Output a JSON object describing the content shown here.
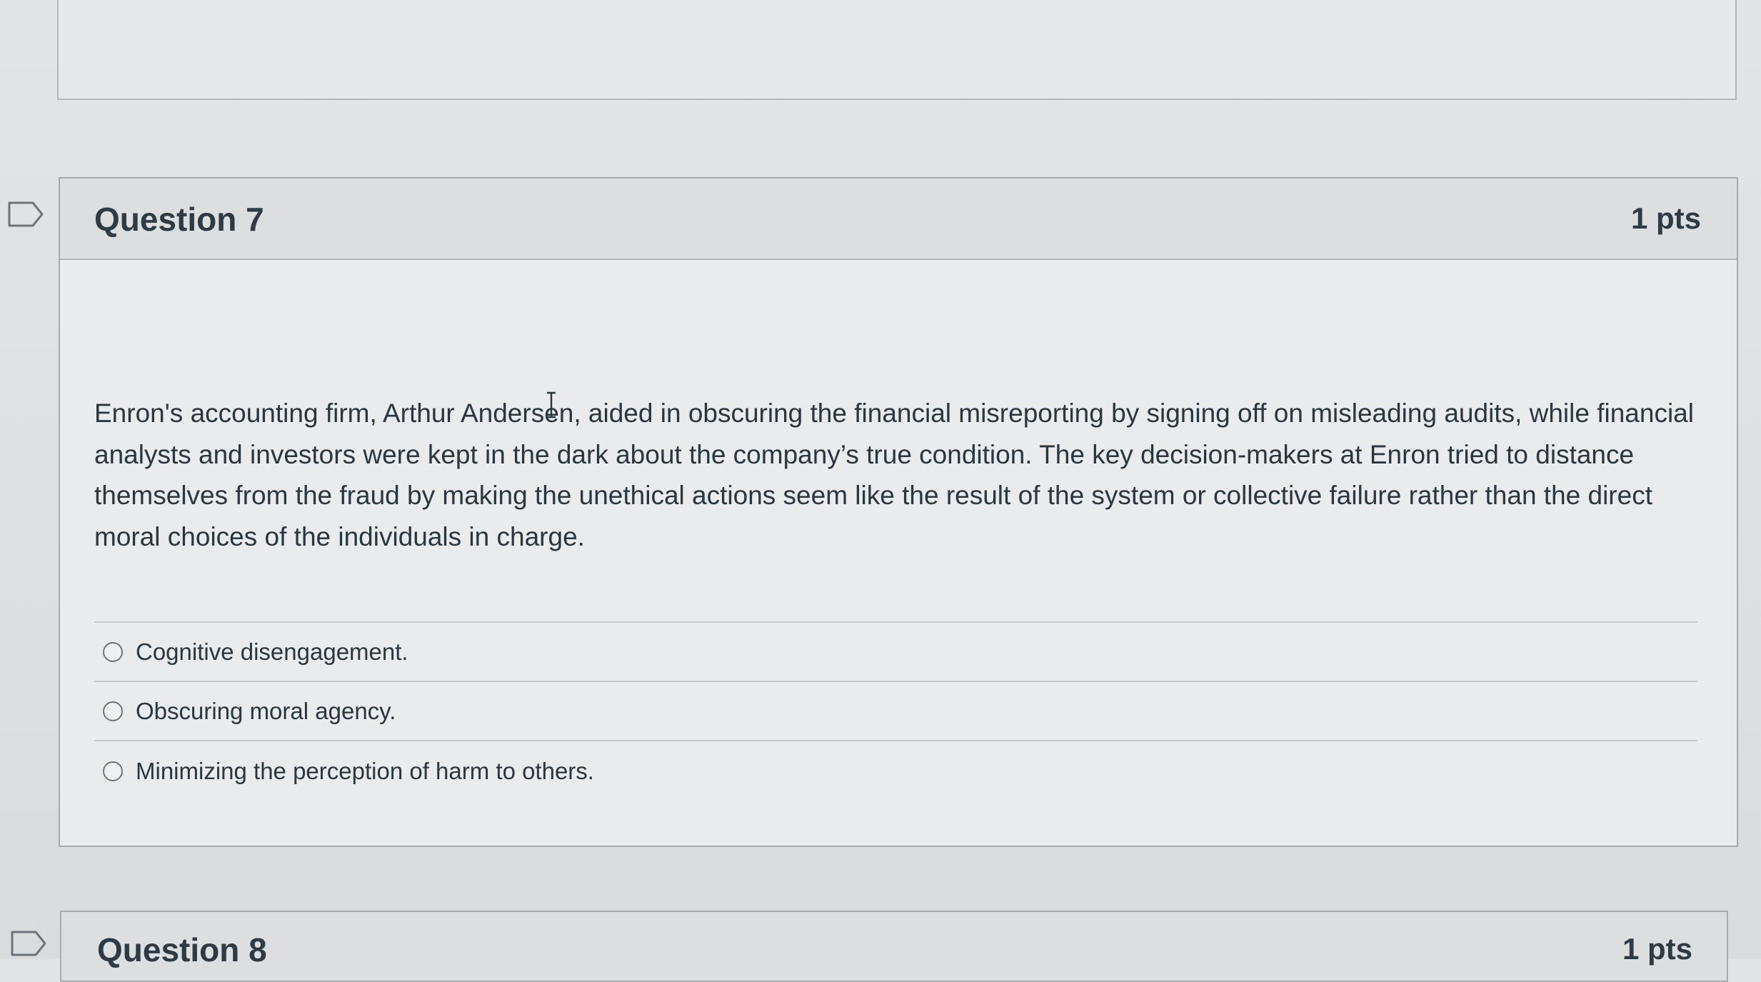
{
  "questions": [
    {
      "title": "Question 7",
      "points": "1 pts",
      "text": "Enron's accounting firm, Arthur Andersen, aided in obscuring the financial misreporting by signing off on misleading audits, while financial analysts and investors were kept in the dark about the company’s true condition. The key decision-makers at Enron tried to distance themselves from the fraud by making the unethical actions seem like the result of the system or collective failure rather than the direct moral choices of the individuals in charge.",
      "answers": [
        {
          "label": "Cognitive disengagement.",
          "selected": false
        },
        {
          "label": "Obscuring moral agency.",
          "selected": false
        },
        {
          "label": "Minimizing the perception of harm to others.",
          "selected": false
        }
      ]
    },
    {
      "title": "Question 8",
      "points": "1 pts"
    }
  ],
  "icons": {
    "flag": "flag-icon",
    "cursor": "text-cursor-icon"
  },
  "colors": {
    "page_background": "#e0e2e4",
    "header_background": "#dcdee0",
    "text": "#2d3b45",
    "border": "#a7abaf"
  }
}
